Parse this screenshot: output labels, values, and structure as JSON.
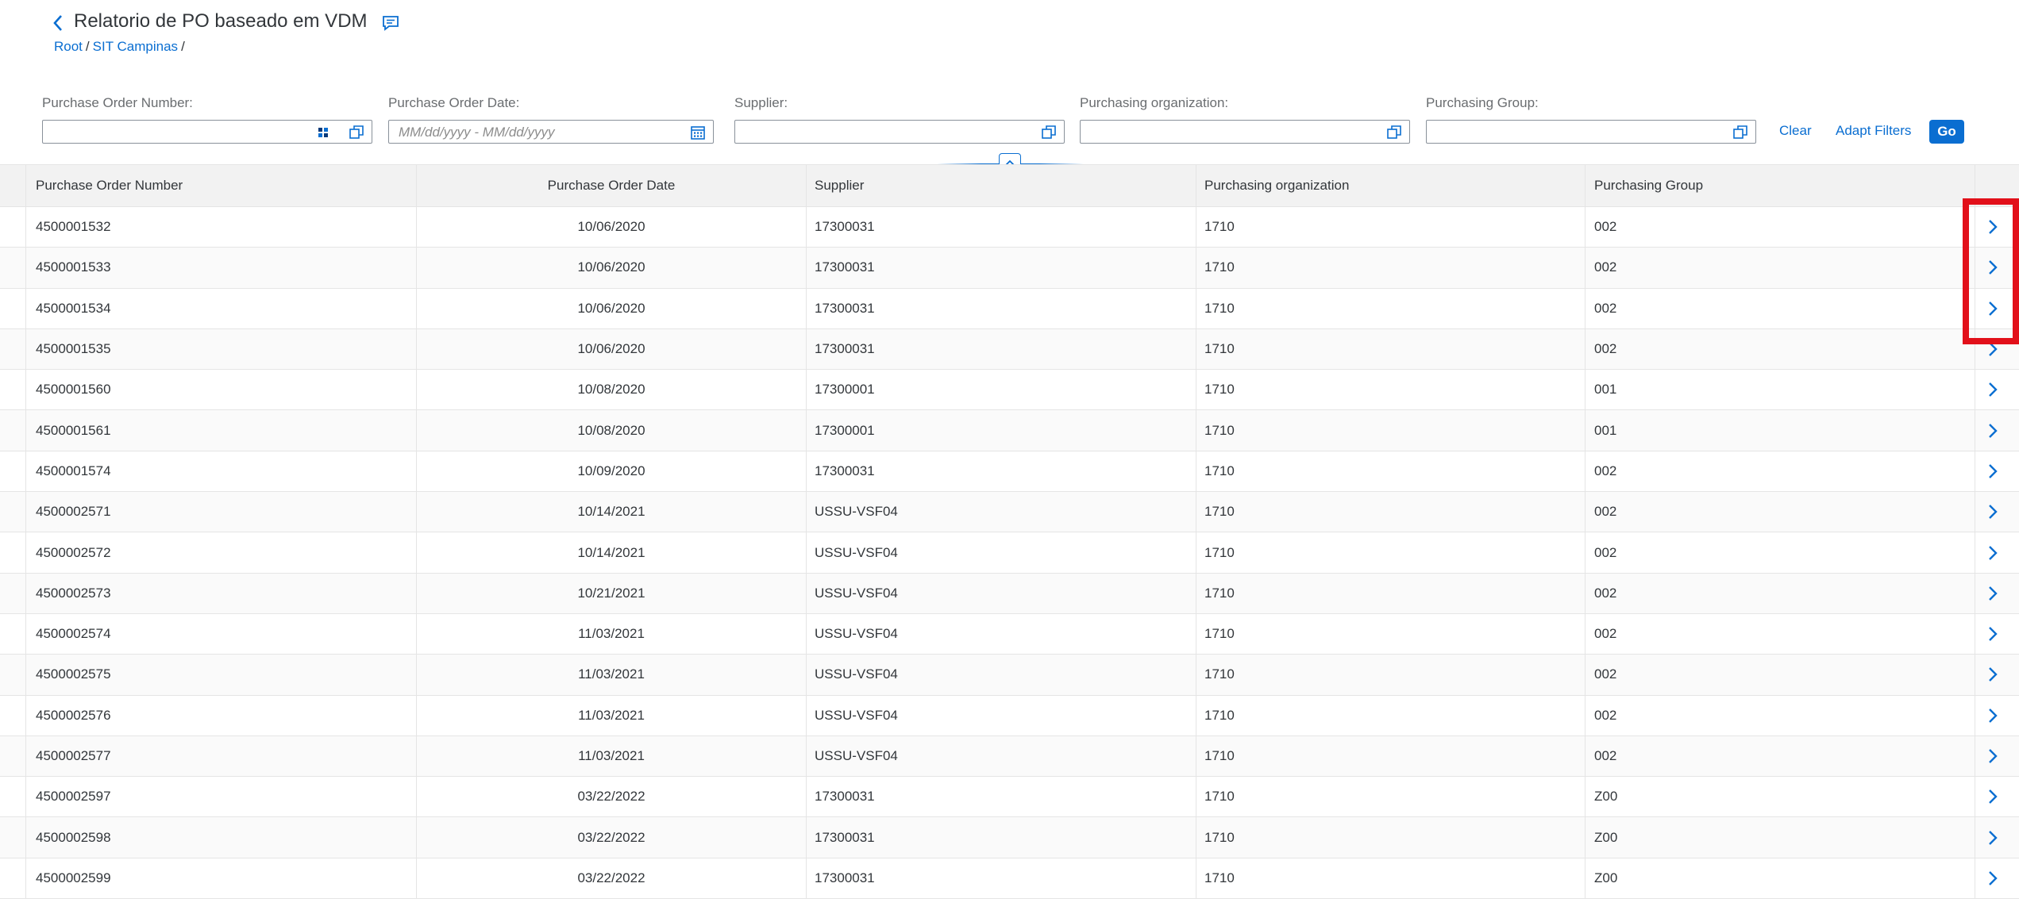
{
  "header": {
    "title": "Relatorio de PO baseado em VDM",
    "breadcrumb": [
      {
        "label": "Root"
      },
      {
        "label": "SIT Campinas"
      }
    ]
  },
  "filters": {
    "po_number": {
      "label": "Purchase Order Number:",
      "value": ""
    },
    "po_date": {
      "label": "Purchase Order Date:",
      "placeholder": "MM/dd/yyyy - MM/dd/yyyy"
    },
    "supplier": {
      "label": "Supplier:",
      "value": ""
    },
    "purchasing_org": {
      "label": "Purchasing organization:",
      "value": ""
    },
    "purchasing_group": {
      "label": "Purchasing Group:",
      "value": ""
    },
    "clear_label": "Clear",
    "adapt_label": "Adapt Filters",
    "go_label": "Go"
  },
  "table": {
    "columns": [
      "Purchase Order Number",
      "Purchase Order Date",
      "Supplier",
      "Purchasing organization",
      "Purchasing Group"
    ],
    "rows": [
      [
        "4500001532",
        "10/06/2020",
        "17300031",
        "1710",
        "002"
      ],
      [
        "4500001533",
        "10/06/2020",
        "17300031",
        "1710",
        "002"
      ],
      [
        "4500001534",
        "10/06/2020",
        "17300031",
        "1710",
        "002"
      ],
      [
        "4500001535",
        "10/06/2020",
        "17300031",
        "1710",
        "002"
      ],
      [
        "4500001560",
        "10/08/2020",
        "17300001",
        "1710",
        "001"
      ],
      [
        "4500001561",
        "10/08/2020",
        "17300001",
        "1710",
        "001"
      ],
      [
        "4500001574",
        "10/09/2020",
        "17300031",
        "1710",
        "002"
      ],
      [
        "4500002571",
        "10/14/2021",
        "USSU-VSF04",
        "1710",
        "002"
      ],
      [
        "4500002572",
        "10/14/2021",
        "USSU-VSF04",
        "1710",
        "002"
      ],
      [
        "4500002573",
        "10/21/2021",
        "USSU-VSF04",
        "1710",
        "002"
      ],
      [
        "4500002574",
        "11/03/2021",
        "USSU-VSF04",
        "1710",
        "002"
      ],
      [
        "4500002575",
        "11/03/2021",
        "USSU-VSF04",
        "1710",
        "002"
      ],
      [
        "4500002576",
        "11/03/2021",
        "USSU-VSF04",
        "1710",
        "002"
      ],
      [
        "4500002577",
        "11/03/2021",
        "USSU-VSF04",
        "1710",
        "002"
      ],
      [
        "4500002597",
        "03/22/2022",
        "17300031",
        "1710",
        "Z00"
      ],
      [
        "4500002598",
        "03/22/2022",
        "17300031",
        "1710",
        "Z00"
      ],
      [
        "4500002599",
        "03/22/2022",
        "17300031",
        "1710",
        "Z00"
      ]
    ]
  },
  "colors": {
    "accent": "#0a6ed1",
    "highlight": "#e2101a",
    "header_bg": "#f2f2f2"
  }
}
